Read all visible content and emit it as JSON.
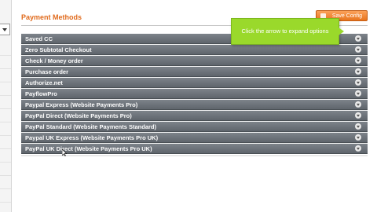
{
  "page": {
    "title": "Payment Methods",
    "save_button": "Save Config"
  },
  "tooltip": {
    "text": "Click the arrow to expand options"
  },
  "sections": [
    {
      "label": "Saved CC"
    },
    {
      "label": "Zero Subtotal Checkout"
    },
    {
      "label": "Check / Money order"
    },
    {
      "label": "Purchase order"
    },
    {
      "label": "Authorize.net"
    },
    {
      "label": "PayflowPro"
    },
    {
      "label": "Paypal Express (Website Payments Pro)"
    },
    {
      "label": "PayPal Direct (Website Payments Pro)"
    },
    {
      "label": "PayPal Standard (Website Payments Standard)"
    },
    {
      "label": "Paypal UK Express (Website Payments Pro UK)"
    },
    {
      "label": "PayPal UK Direct (Website Payments Pro UK)"
    }
  ],
  "icons": {
    "expand": "chevron-down-icon",
    "save": "save-icon"
  },
  "colors": {
    "accent": "#e06a1c",
    "section_bar": "#6b7178",
    "tooltip": "#9ad92b"
  }
}
